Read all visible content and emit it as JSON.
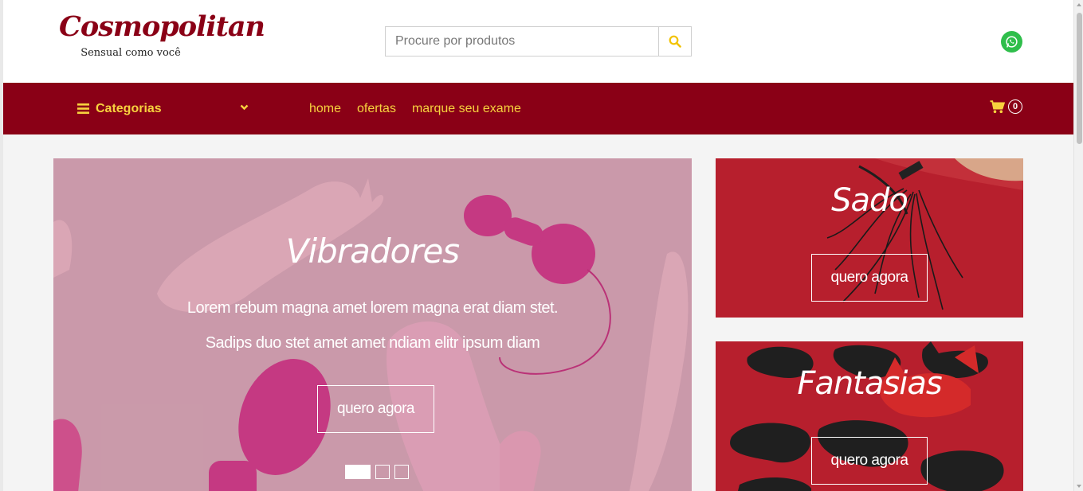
{
  "header": {
    "logo_title": "Cosmopolitan",
    "logo_tagline": "Sensual como você",
    "search_placeholder": "Procure por produtos",
    "search_icon": "search-icon",
    "whatsapp_icon": "whatsapp-icon"
  },
  "nav": {
    "categories_label": "Categorias",
    "links": [
      "home",
      "ofertas",
      "marque seu exame"
    ],
    "cart_count": "0"
  },
  "hero": {
    "title": "Vibradores",
    "text_line1": "Lorem rebum magna amet lorem magna erat diam stet.",
    "text_line2": "Sadips duo stet amet amet ndiam elitr ipsum diam",
    "button_label": "quero agora",
    "slides_total": 3,
    "active_slide": 1
  },
  "banners": [
    {
      "title": "Sado",
      "button_label": "quero agora"
    },
    {
      "title": "Fantasias",
      "button_label": "quero agora"
    }
  ],
  "colors": {
    "brand": "#8a0016",
    "accent": "#f7d23e",
    "whatsapp": "#2fbe4b"
  }
}
